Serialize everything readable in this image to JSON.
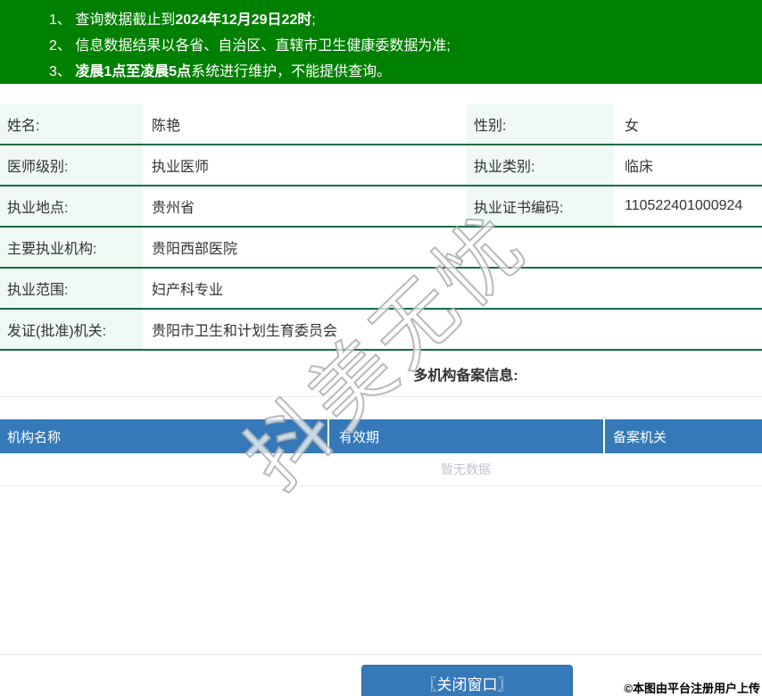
{
  "notices": {
    "items": [
      {
        "prefix": "1、 查询数据截止到",
        "bold": "2024年12月29日22时",
        "suffix": ";"
      },
      {
        "prefix": "2、 信息数据结果以各省、自治区、直辖市卫生健康委数据为准;",
        "bold": "",
        "suffix": ""
      },
      {
        "prefix": "3、 ",
        "bold": "凌晨1点至凌晨5点",
        "suffix": "系统进行维护，不能提供查询。"
      }
    ]
  },
  "info": {
    "rows": [
      {
        "label1": "姓名:",
        "value1": "陈艳",
        "label2": "性别:",
        "value2": "女"
      },
      {
        "label1": "医师级别:",
        "value1": "执业医师",
        "label2": "执业类别:",
        "value2": "临床"
      },
      {
        "label1": "执业地点:",
        "value1": "贵州省",
        "label2": "执业证书编码:",
        "value2": "110522401000924"
      },
      {
        "label1": "主要执业机构:",
        "value1": "贵阳西部医院"
      },
      {
        "label1": "执业范围:",
        "value1": "妇产科专业"
      },
      {
        "label1": "发证(批准)机关:",
        "value1": "贵阳市卫生和计划生育委员会"
      }
    ]
  },
  "registration": {
    "heading": "多机构备案信息:",
    "columns": [
      "机构名称",
      "有效期",
      "备案机关"
    ],
    "empty_text": "暂无数据"
  },
  "footer": {
    "close_button": "〖关闭窗口〗",
    "copyright": "©本图由平台注册用户上传"
  },
  "watermark": "抖美无忧",
  "colors": {
    "header_green": "#008000",
    "row_border_green": "#0e6c45",
    "label_bg_green": "#eefaf3",
    "table_header_blue": "#3579b8",
    "light_border": "#ebeef5",
    "empty_text_gray": "#c0c4cc"
  }
}
